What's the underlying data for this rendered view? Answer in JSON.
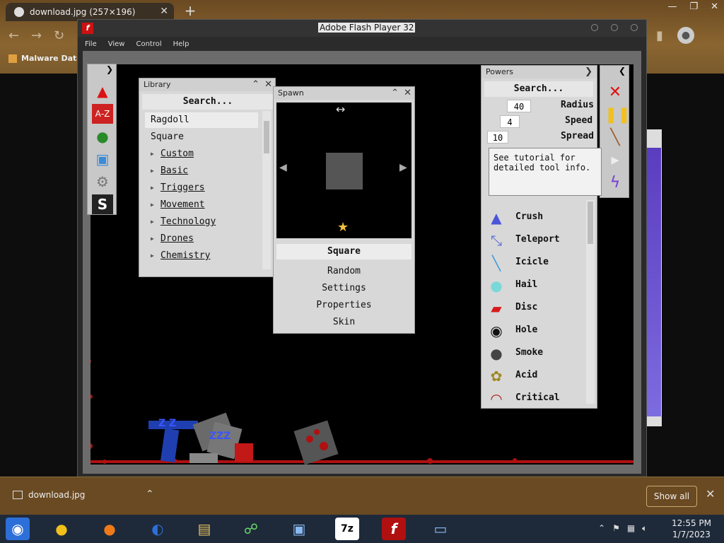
{
  "browser": {
    "tab_title": "download.jpg (257×196)",
    "bookmark": "Malware Data",
    "side_purple": "#6a55d6"
  },
  "flash": {
    "title": "Adobe Flash Player 32",
    "menu": [
      "File",
      "View",
      "Control",
      "Help"
    ]
  },
  "library": {
    "title": "Library",
    "search": "Search...",
    "items": [
      "Ragdoll",
      "Square"
    ],
    "categories": [
      "Custom",
      "Basic",
      "Triggers",
      "Movement",
      "Technology",
      "Drones",
      "Chemistry"
    ]
  },
  "spawn": {
    "title": "Spawn",
    "selected": "Square",
    "options": [
      "Random",
      "Settings",
      "Properties",
      "Skin"
    ]
  },
  "powers": {
    "title": "Powers",
    "search": "Search...",
    "params": [
      {
        "value": "40",
        "label": "Radius"
      },
      {
        "value": "4",
        "label": "Speed"
      },
      {
        "value": "10",
        "label": "Spread"
      }
    ],
    "tooltip": "See tutorial for detailed tool info.",
    "list": [
      {
        "name": "Crush",
        "icon": "crush-icon"
      },
      {
        "name": "Teleport",
        "icon": "teleport-icon"
      },
      {
        "name": "Icicle",
        "icon": "icicle-icon"
      },
      {
        "name": "Hail",
        "icon": "hail-icon"
      },
      {
        "name": "Disc",
        "icon": "disc-icon"
      },
      {
        "name": "Hole",
        "icon": "hole-icon"
      },
      {
        "name": "Smoke",
        "icon": "smoke-icon"
      },
      {
        "name": "Acid",
        "icon": "acid-icon"
      },
      {
        "name": "Critical",
        "icon": "critical-icon"
      }
    ]
  },
  "download_bar": {
    "file": "download.jpg",
    "show_all": "Show all"
  },
  "taskbar": {
    "time": "12:55 PM",
    "date": "1/7/2023",
    "sevenzip_label": "7z"
  }
}
